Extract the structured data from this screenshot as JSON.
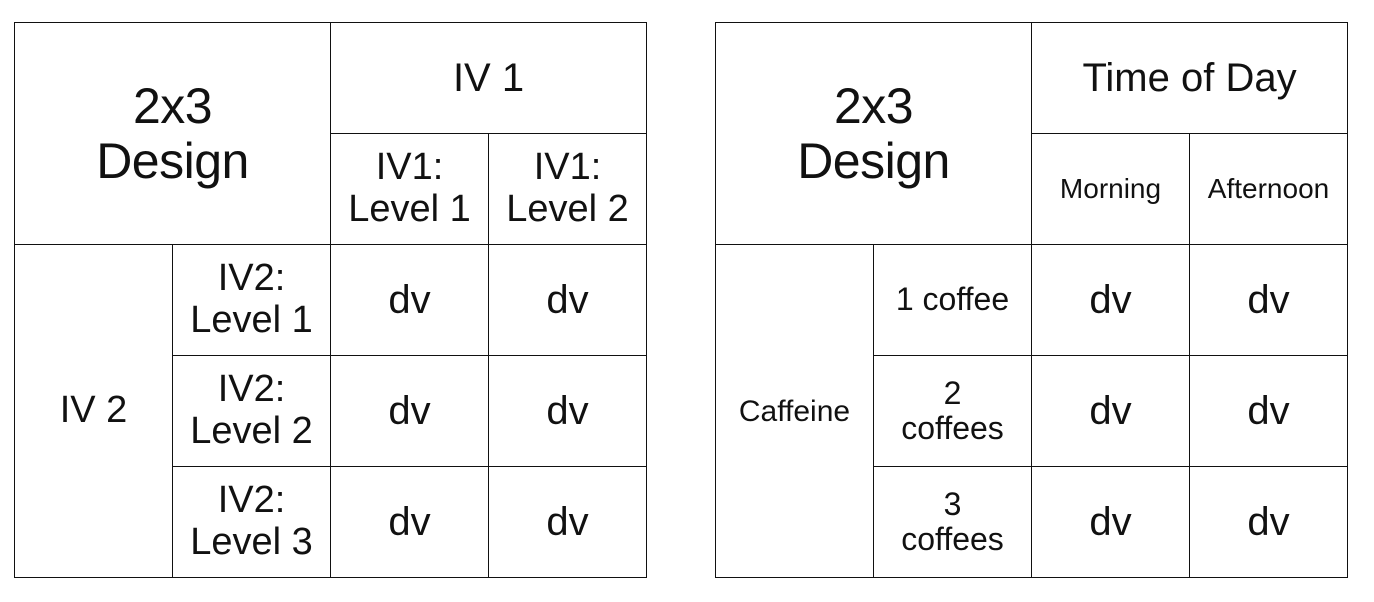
{
  "tables": [
    {
      "title_line1": "2x3",
      "title_line2": "Design",
      "column_factor": "IV 1",
      "column_levels": [
        {
          "line1": "IV1:",
          "line2": "Level 1"
        },
        {
          "line1": "IV1:",
          "line2": "Level 2"
        }
      ],
      "row_factor": "IV 2",
      "row_levels": [
        {
          "line1": "IV2:",
          "line2": "Level 1"
        },
        {
          "line1": "IV2:",
          "line2": "Level 2"
        },
        {
          "line1": "IV2:",
          "line2": "Level 3"
        }
      ],
      "cells": [
        [
          "dv",
          "dv"
        ],
        [
          "dv",
          "dv"
        ],
        [
          "dv",
          "dv"
        ]
      ]
    },
    {
      "title_line1": "2x3",
      "title_line2": "Design",
      "column_factor": "Time of Day",
      "column_levels": [
        {
          "line1": "Morning"
        },
        {
          "line1": "Afternoon"
        }
      ],
      "row_factor": "Caffeine",
      "row_levels": [
        {
          "line1": "1 coffee",
          "line2": ""
        },
        {
          "line1": "2",
          "line2": "coffees"
        },
        {
          "line1": "3",
          "line2": "coffees"
        }
      ],
      "cells": [
        [
          "dv",
          "dv"
        ],
        [
          "dv",
          "dv"
        ],
        [
          "dv",
          "dv"
        ]
      ]
    }
  ]
}
